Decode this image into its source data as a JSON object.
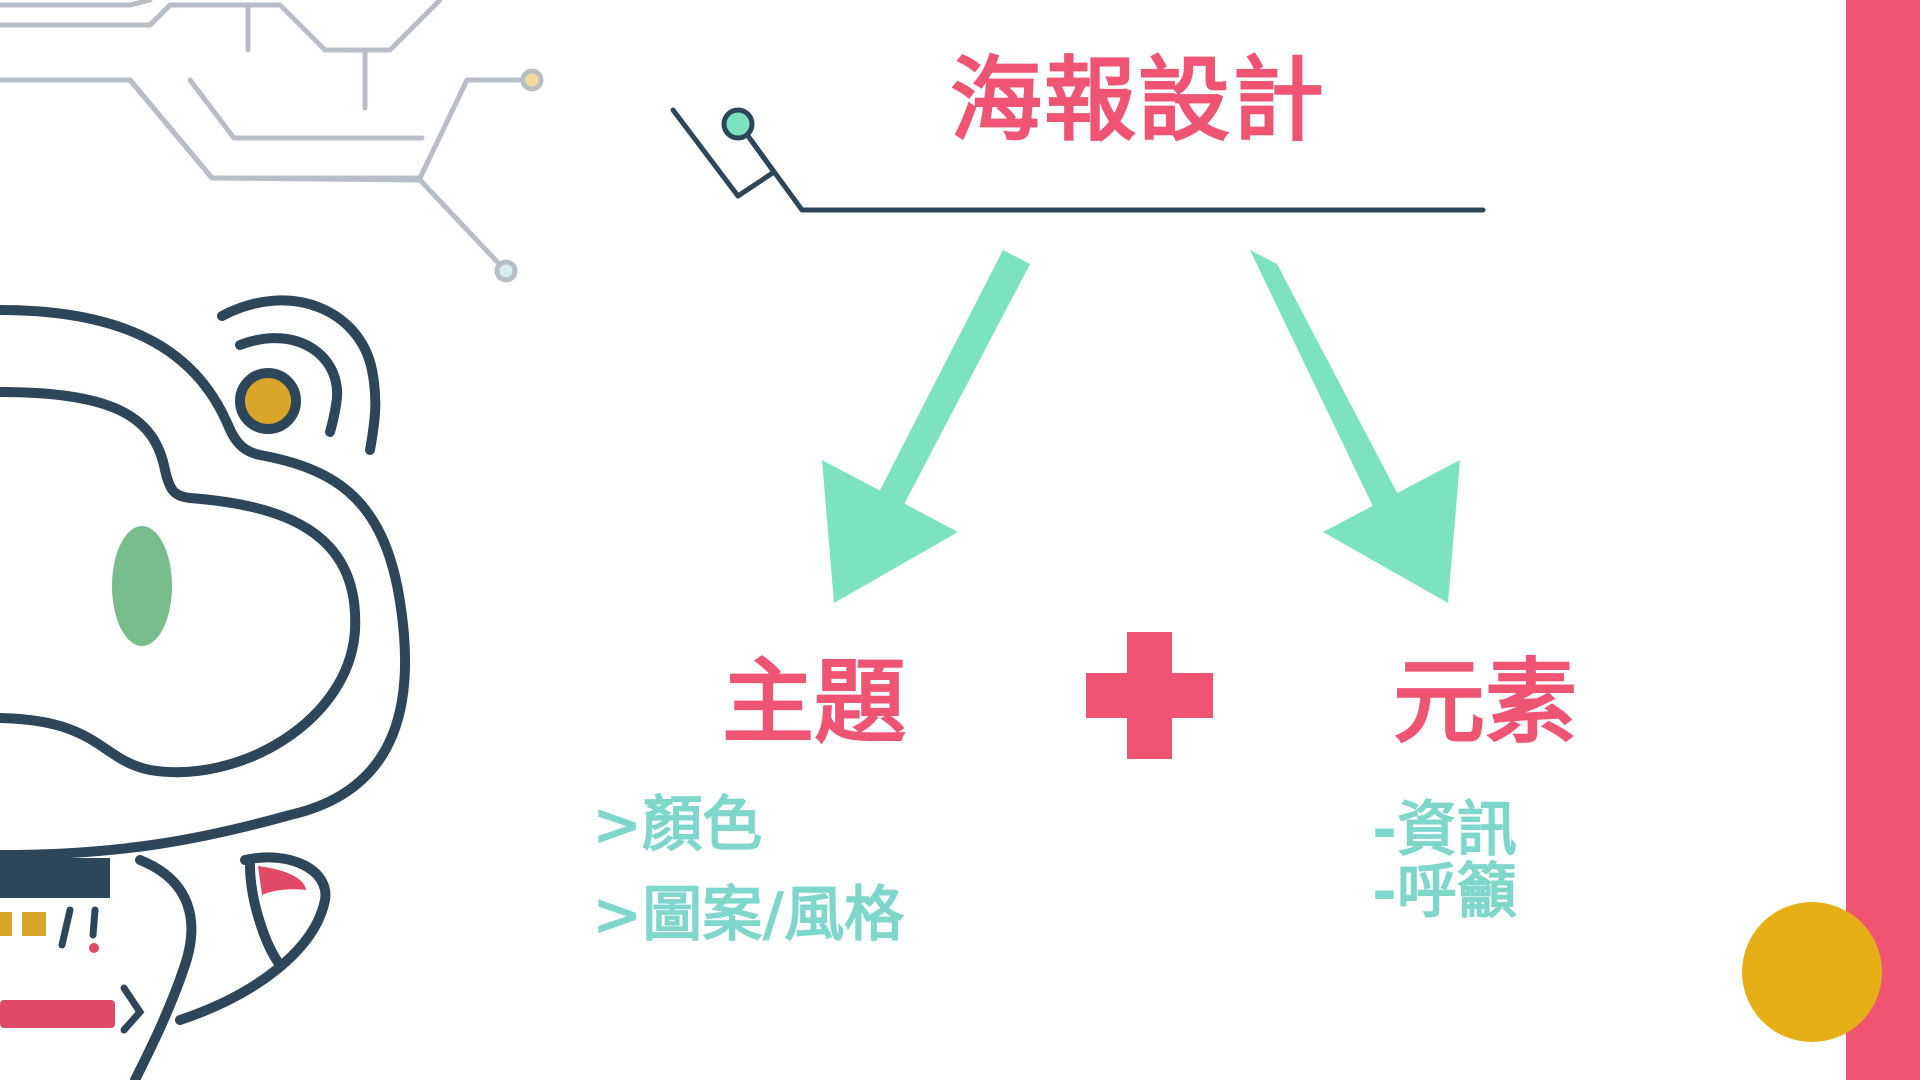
{
  "title": "海報設計",
  "branches": {
    "left": {
      "title": "主題",
      "items": [
        ">顏色",
        ">圖案/風格"
      ]
    },
    "operator": "plus",
    "right": {
      "title": "元素",
      "items": [
        "-資訊",
        "-呼籲"
      ]
    }
  },
  "colors": {
    "title": "#ef5473",
    "accent_pink": "#ef5473",
    "arrow": "#7de2bf",
    "item_text": "#7fd7cc",
    "line": "#2e465a",
    "circuit": "#b7bec6",
    "gold": "#e6ae17",
    "robot_green": "#79bd8c"
  },
  "icons": {
    "plus": "plus-icon",
    "arrows": "down-arrow-icon",
    "robot": "robot-illustration",
    "circuit": "circuit-lines-decoration",
    "gold_circle": "gold-circle-decoration",
    "side_bar": "pink-side-bar"
  }
}
